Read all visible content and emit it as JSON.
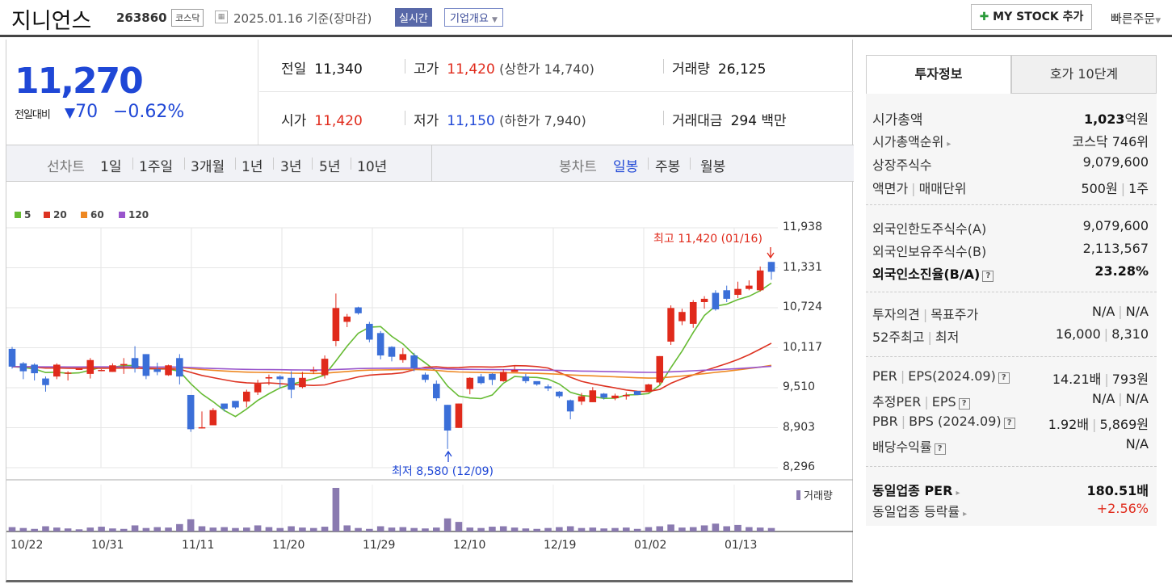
{
  "header": {
    "name": "지니언스",
    "code": "263860",
    "market": "코스닥",
    "date": "2025.01.16",
    "basis": "기준(장마감)",
    "realtime": "실시간",
    "company": "기업개요",
    "my_stock": "MY STOCK 추가",
    "quick_order": "빠른주문"
  },
  "quote": {
    "price": "11,270",
    "diff_label": "전일대비",
    "diff": "70",
    "diff_rate": "−0.62%",
    "prev_label": "전일",
    "prev": "11,340",
    "high_label": "고가",
    "high": "11,420",
    "upper_limit": "(상한가 14,740)",
    "volume_label": "거래량",
    "volume": "26,125",
    "open_label": "시가",
    "open": "11,420",
    "low_label": "저가",
    "low": "11,150",
    "lower_limit": "(하한가 7,940)",
    "amount_label": "거래대금",
    "amount": "294",
    "amount_unit": "백만"
  },
  "periods": {
    "label": "선차트",
    "items": [
      "1일",
      "1주일",
      "3개월",
      "1년",
      "3년",
      "5년",
      "10년"
    ]
  },
  "candle": {
    "label": "봉차트",
    "items": [
      "일봉",
      "주봉",
      "월봉"
    ],
    "selected": "일봉"
  },
  "chart_data": {
    "type": "candlestick",
    "legend": [
      "5",
      "20",
      "60",
      "120"
    ],
    "ma_colors": {
      "5": "#66bb33",
      "20": "#dd3322",
      "60": "#ee8822",
      "120": "#9955cc"
    },
    "y_ticks": [
      "11,938",
      "11,331",
      "10,724",
      "10,117",
      "9,510",
      "8,903",
      "8,296"
    ],
    "ylim": [
      8296,
      11938
    ],
    "x_ticks": [
      "10/22",
      "10/31",
      "11/11",
      "11/20",
      "11/29",
      "12/10",
      "12/19",
      "01/02",
      "01/13"
    ],
    "high_annotation": "최고 11,420 (01/16)",
    "low_annotation": "최저 8,580 (12/09)",
    "volume_label": "거래량",
    "candles": [
      [
        10100,
        9830,
        10130,
        9800
      ],
      [
        9880,
        9760,
        9900,
        9640
      ],
      [
        9860,
        9730,
        9880,
        9620
      ],
      [
        9650,
        9550,
        9680,
        9450
      ],
      [
        9680,
        9860,
        9880,
        9640
      ],
      [
        9740,
        9740,
        9760,
        9620
      ],
      [
        9780,
        9800,
        9800,
        9780
      ],
      [
        9720,
        9930,
        9960,
        9650
      ],
      [
        9770,
        9780,
        9790,
        9760
      ],
      [
        9750,
        9850,
        9880,
        9750
      ],
      [
        9850,
        9870,
        9960,
        9720
      ],
      [
        9960,
        9810,
        10140,
        9740
      ],
      [
        10020,
        9690,
        10020,
        9640
      ],
      [
        9790,
        9750,
        9890,
        9700
      ],
      [
        9700,
        9850,
        9860,
        9690
      ],
      [
        9960,
        9680,
        10020,
        9560
      ],
      [
        9400,
        8880,
        9400,
        8840
      ],
      [
        8900,
        8910,
        9150,
        8890
      ],
      [
        8940,
        9170,
        9200,
        8940
      ],
      [
        9270,
        9190,
        9210,
        9150
      ],
      [
        9310,
        9210,
        9220,
        9190
      ],
      [
        9300,
        9450,
        9480,
        9210
      ],
      [
        9440,
        9570,
        9630,
        9400
      ],
      [
        9650,
        9670,
        9710,
        9550
      ],
      [
        9680,
        9640,
        9700,
        9500
      ],
      [
        9660,
        9480,
        9760,
        9350
      ],
      [
        9520,
        9660,
        9750,
        9500
      ],
      [
        9760,
        9780,
        9830,
        9720
      ],
      [
        9700,
        9950,
        10000,
        9650
      ],
      [
        10220,
        10720,
        10940,
        10140
      ],
      [
        10510,
        10590,
        10630,
        10430
      ],
      [
        10730,
        10640,
        10740,
        10620
      ],
      [
        10480,
        10240,
        10510,
        10200
      ],
      [
        10340,
        10000,
        10370,
        9940
      ],
      [
        10130,
        9980,
        10140,
        9910
      ],
      [
        9930,
        10020,
        10110,
        9890
      ],
      [
        10000,
        9810,
        10040,
        9760
      ],
      [
        9710,
        9630,
        9740,
        9590
      ],
      [
        9570,
        9350,
        9620,
        9310
      ],
      [
        9250,
        8860,
        9250,
        8580
      ],
      [
        8900,
        9270,
        9270,
        8900
      ],
      [
        9490,
        9660,
        9670,
        9410
      ],
      [
        9680,
        9580,
        9720,
        9560
      ],
      [
        9720,
        9630,
        9730,
        9550
      ],
      [
        9610,
        9750,
        9790,
        9600
      ],
      [
        9750,
        9780,
        9840,
        9760
      ],
      [
        9680,
        9610,
        9720,
        9580
      ],
      [
        9610,
        9560,
        9580,
        9540
      ],
      [
        9530,
        9500,
        9560,
        9460
      ],
      [
        9450,
        9380,
        9460,
        9350
      ],
      [
        9320,
        9150,
        9330,
        9030
      ],
      [
        9300,
        9380,
        9430,
        9250
      ],
      [
        9290,
        9470,
        9520,
        9290
      ],
      [
        9420,
        9360,
        9430,
        9330
      ],
      [
        9350,
        9390,
        9420,
        9320
      ],
      [
        9380,
        9400,
        9440,
        9330
      ],
      [
        9460,
        9400,
        9410,
        9400
      ],
      [
        9450,
        9560,
        9570,
        9440
      ],
      [
        9590,
        9990,
        9990,
        9560
      ],
      [
        10210,
        10720,
        10760,
        10160
      ],
      [
        10520,
        10660,
        10710,
        10460
      ],
      [
        10480,
        10810,
        10840,
        10420
      ],
      [
        10810,
        10860,
        10900,
        10710
      ],
      [
        10950,
        10700,
        10990,
        10680
      ],
      [
        10990,
        10860,
        11060,
        10810
      ],
      [
        10920,
        11010,
        11120,
        10870
      ],
      [
        11010,
        11060,
        11140,
        10990
      ],
      [
        10990,
        11290,
        11350,
        10970
      ],
      [
        11420,
        11270,
        11420,
        11150
      ]
    ],
    "volumes": [
      10,
      8,
      6,
      12,
      9,
      7,
      5,
      9,
      11,
      7,
      6,
      14,
      8,
      10,
      9,
      17,
      28,
      12,
      9,
      10,
      8,
      9,
      14,
      10,
      8,
      12,
      9,
      8,
      11,
      100,
      14,
      8,
      6,
      12,
      9,
      10,
      8,
      7,
      9,
      30,
      22,
      9,
      8,
      11,
      12,
      9,
      7,
      6,
      8,
      10,
      12,
      8,
      9,
      7,
      8,
      9,
      6,
      10,
      12,
      16,
      9,
      10,
      14,
      18,
      12,
      15,
      10,
      9,
      8
    ]
  },
  "side": {
    "tab_active": "투자정보",
    "tab_other": "호가 10단계",
    "mcap_label": "시가총액",
    "mcap": "1,023",
    "mcap_unit": "억원",
    "rank_label": "시가총액순위",
    "rank": "코스닥 746위",
    "shares_label": "상장주식수",
    "shares": "9,079,600",
    "par_label": "액면가",
    "unit_label": "매매단위",
    "par": "500원",
    "unit": "1주",
    "fl_label": "외국인한도주식수(A)",
    "fl": "9,079,600",
    "fh_label": "외국인보유주식수(B)",
    "fh": "2,113,567",
    "fr_label": "외국인소진율(B/A)",
    "fr": "23.28%",
    "opinion_label": "투자의견",
    "target_label": "목표주가",
    "opinion": "N/A",
    "target": "N/A",
    "w52_label": "52주최고",
    "w52low_label": "최저",
    "w52h": "16,000",
    "w52l": "8,310",
    "per_label": "PER",
    "eps_label": "EPS(2024.09)",
    "per": "14.21배",
    "eps": "793원",
    "eper_label": "추정PER",
    "eeps_label": "EPS",
    "eper": "N/A",
    "eeps": "N/A",
    "pbr_label": "PBR",
    "bps_label": "BPS (2024.09)",
    "pbr": "1.92배",
    "bps": "5,869원",
    "div_label": "배당수익률",
    "div": "N/A",
    "ind_per_label": "동일업종 PER",
    "ind_per": "180.51배",
    "ind_chg_label": "동일업종 등락률",
    "ind_chg": "+2.56%"
  }
}
